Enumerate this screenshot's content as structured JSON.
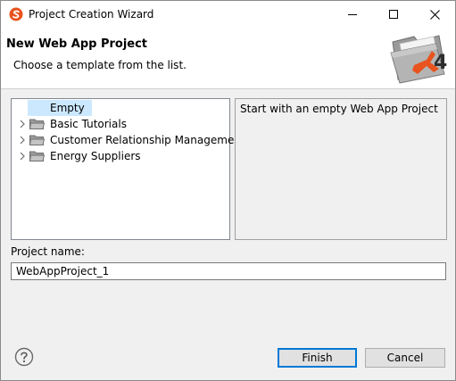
{
  "window": {
    "title": "Project Creation Wizard",
    "icon": "app-logo-icon"
  },
  "banner": {
    "title": "New Web App Project",
    "subtitle": "Choose a template from the list.",
    "logo": "x4-folder-logo"
  },
  "tree": {
    "items": [
      {
        "label": "Empty",
        "expandable": false,
        "selected": true,
        "icon": ""
      },
      {
        "label": "Basic Tutorials",
        "expandable": true,
        "selected": false,
        "icon": "folder-icon"
      },
      {
        "label": "Customer Relationship Management",
        "expandable": true,
        "selected": false,
        "icon": "folder-icon"
      },
      {
        "label": "Energy Suppliers",
        "expandable": true,
        "selected": false,
        "icon": "folder-icon"
      }
    ]
  },
  "description": {
    "text": "Start with an empty Web App Project"
  },
  "project": {
    "name_label": "Project name:",
    "name_value": "WebAppProject_1"
  },
  "buttons": {
    "finish_label": "Finish",
    "cancel_label": "Cancel"
  },
  "colors": {
    "selection": "#cce8ff",
    "accent": "#0078d7",
    "logo_orange": "#e8531e"
  }
}
